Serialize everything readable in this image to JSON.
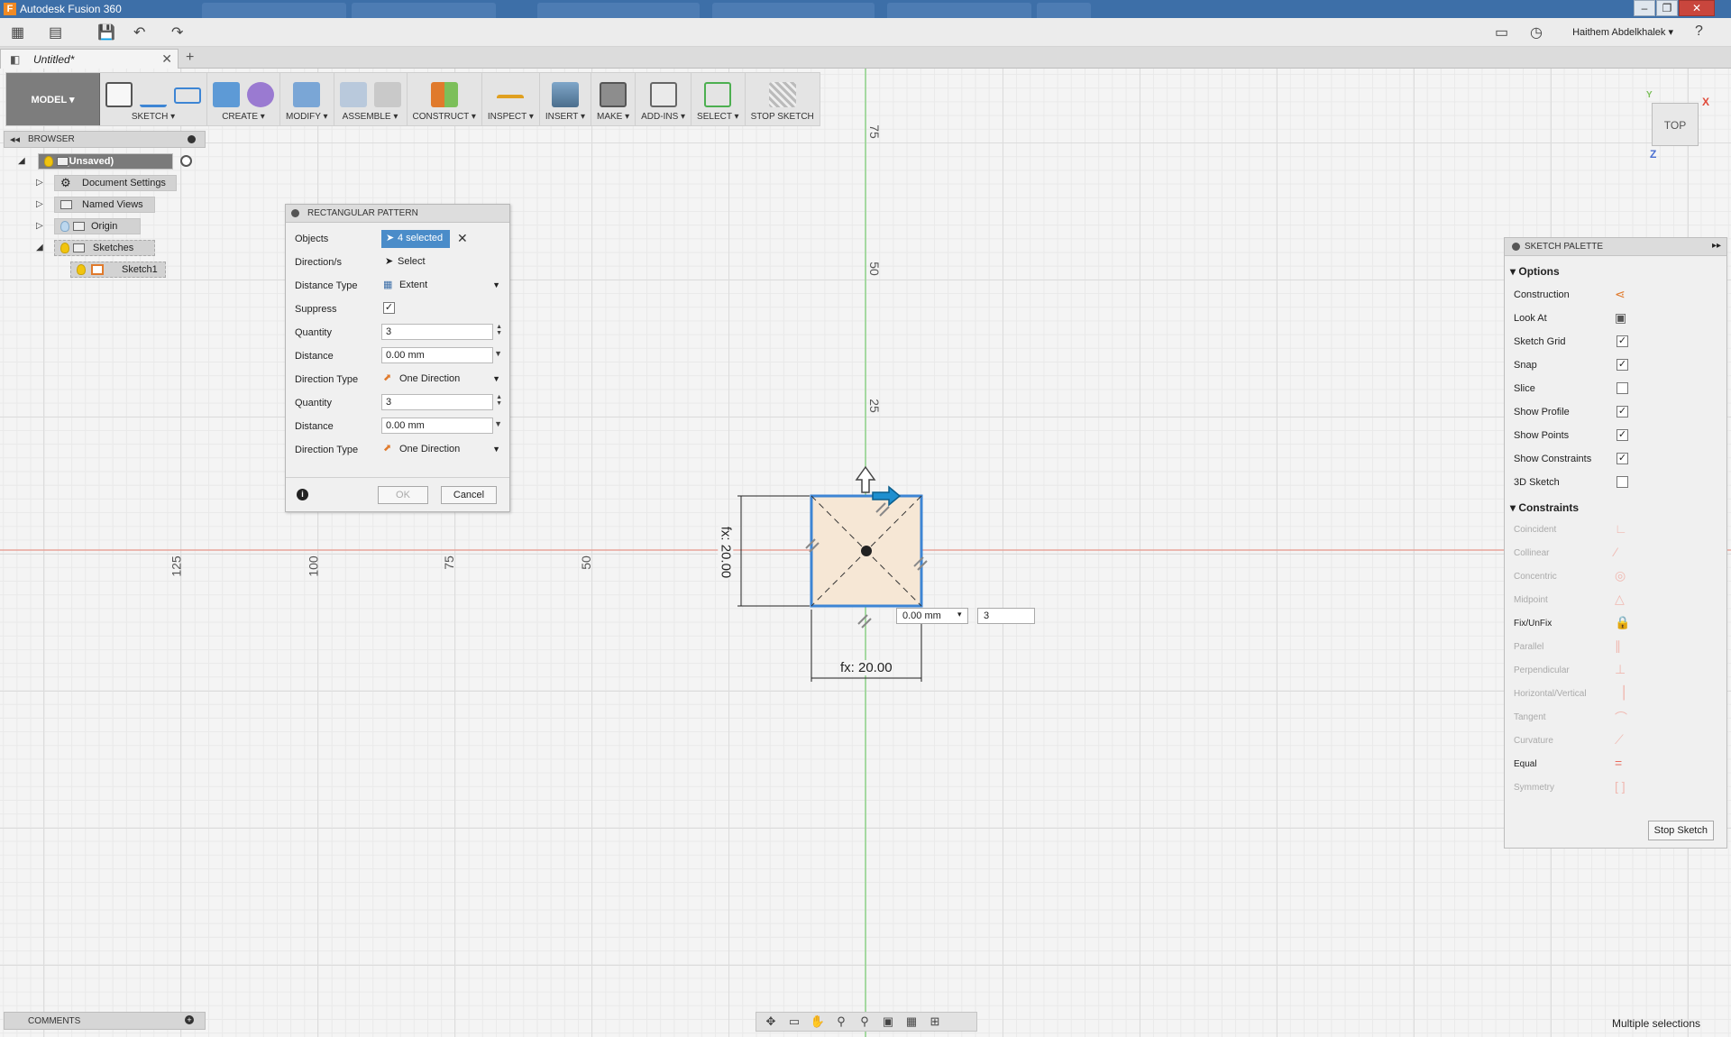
{
  "app": {
    "window_title": "Autodesk Fusion 360",
    "app_icon": "F",
    "user_name": "Haithem Abdelkhalek",
    "doc_tab": "Untitled*"
  },
  "toolbar": {
    "workspace": "MODEL ▾",
    "groups": [
      {
        "label": "SKETCH ▾"
      },
      {
        "label": "CREATE ▾"
      },
      {
        "label": "MODIFY ▾"
      },
      {
        "label": "ASSEMBLE ▾"
      },
      {
        "label": "CONSTRUCT ▾"
      },
      {
        "label": "INSPECT ▾"
      },
      {
        "label": "INSERT ▾"
      },
      {
        "label": "MAKE ▾"
      },
      {
        "label": "ADD-INS ▾"
      },
      {
        "label": "SELECT ▾"
      },
      {
        "label": "STOP SKETCH"
      }
    ]
  },
  "browser": {
    "title": "BROWSER",
    "root": "(Unsaved)",
    "items": [
      "Document Settings",
      "Named Views",
      "Origin",
      "Sketches",
      "Sketch1"
    ]
  },
  "pattern_dialog": {
    "title": "RECTANGULAR PATTERN",
    "objects_label": "Objects",
    "objects_value": "4 selected",
    "directions_label": "Direction/s",
    "directions_value": "Select",
    "distance_type_label": "Distance Type",
    "distance_type_value": "Extent",
    "suppress_label": "Suppress",
    "quantity_label": "Quantity",
    "quantity1": "3",
    "distance_label": "Distance",
    "distance1": "0.00 mm",
    "direction_type_label": "Direction Type",
    "direction_type1": "One Direction",
    "quantity2": "3",
    "distance2": "0.00 mm",
    "direction_type2": "One Direction",
    "ok": "OK",
    "cancel": "Cancel"
  },
  "palette": {
    "title": "SKETCH PALETTE",
    "options_header": "Options",
    "options": [
      {
        "label": "Construction",
        "kind": "icon"
      },
      {
        "label": "Look At",
        "kind": "icon"
      },
      {
        "label": "Sketch Grid",
        "kind": "check",
        "checked": true
      },
      {
        "label": "Snap",
        "kind": "check",
        "checked": true
      },
      {
        "label": "Slice",
        "kind": "check",
        "checked": false
      },
      {
        "label": "Show Profile",
        "kind": "check",
        "checked": true
      },
      {
        "label": "Show Points",
        "kind": "check",
        "checked": true
      },
      {
        "label": "Show Constraints",
        "kind": "check",
        "checked": true
      },
      {
        "label": "3D Sketch",
        "kind": "check",
        "checked": false
      }
    ],
    "constraints_header": "Constraints",
    "constraints": [
      {
        "label": "Coincident",
        "enabled": false
      },
      {
        "label": "Collinear",
        "enabled": false
      },
      {
        "label": "Concentric",
        "enabled": false
      },
      {
        "label": "Midpoint",
        "enabled": false
      },
      {
        "label": "Fix/UnFix",
        "enabled": true
      },
      {
        "label": "Parallel",
        "enabled": false
      },
      {
        "label": "Perpendicular",
        "enabled": false
      },
      {
        "label": "Horizontal/Vertical",
        "enabled": false
      },
      {
        "label": "Tangent",
        "enabled": false
      },
      {
        "label": "Curvature",
        "enabled": false
      },
      {
        "label": "Equal",
        "enabled": true
      },
      {
        "label": "Symmetry",
        "enabled": false
      }
    ],
    "stop_sketch": "Stop Sketch"
  },
  "viewcube": {
    "face": "TOP",
    "x": "X",
    "y": "Y",
    "z": "Z"
  },
  "canvas": {
    "ruler_v": [
      "75",
      "50",
      "25"
    ],
    "ruler_h": [
      "125",
      "100",
      "75",
      "50"
    ],
    "dim_width": "fx: 20.00",
    "dim_height": "fx: 20.00",
    "field_distance": "0.00 mm",
    "field_quantity": "3"
  },
  "comments": {
    "title": "COMMENTS"
  },
  "status": "Multiple selections",
  "colors": {
    "accent": "#4a8cc9",
    "sketch_fill": "#f6e7d5",
    "titlebar": "#3d6fa8"
  }
}
